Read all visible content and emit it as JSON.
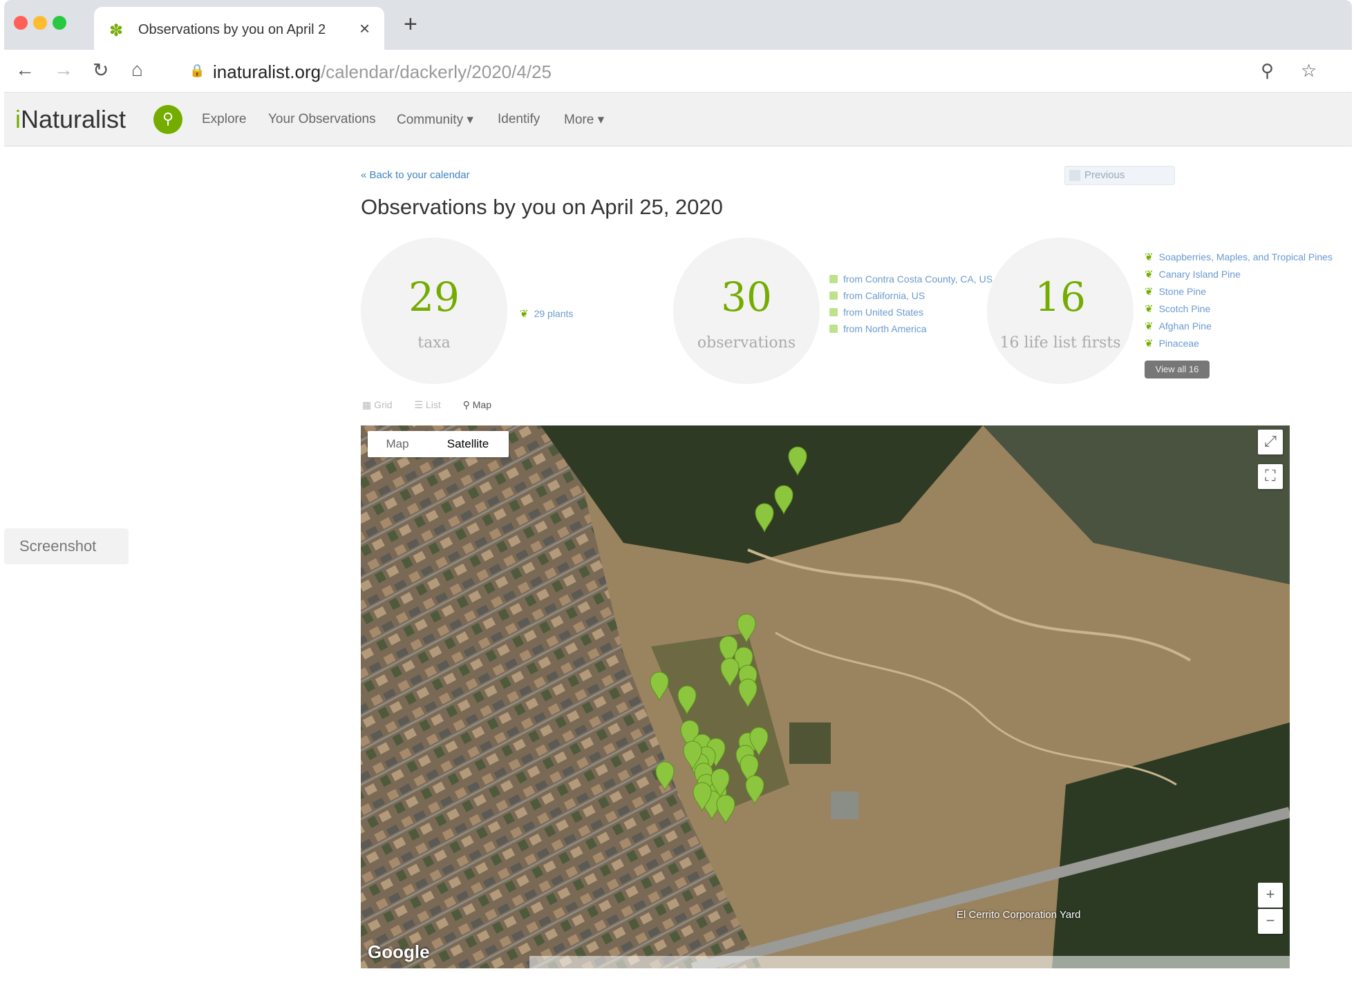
{
  "browser": {
    "tab_title": "Observations by you on April 2",
    "url_domain": "inaturalist.org",
    "url_path": "/calendar/dackerly/2020/4/25"
  },
  "site": {
    "logo_i": "i",
    "logo_rest": "Naturalist",
    "nav": [
      "Explore",
      "Your Observations",
      "Community ▾",
      "Identify",
      "More ▾"
    ]
  },
  "side_label": "Screenshot",
  "page": {
    "back_link": "« Back to your calendar",
    "previous_label": "Previous",
    "title": "Observations by you on April 25, 2020"
  },
  "stats": {
    "taxa": {
      "value": "29",
      "label": "taxa",
      "note": "29 plants"
    },
    "observations": {
      "value": "30",
      "label": "observations",
      "places": [
        "from Contra Costa County, CA, US",
        "from California, US",
        "from United States",
        "from North America"
      ]
    },
    "life_list": {
      "value": "16",
      "label": "16 life list firsts",
      "items": [
        "Soapberries, Maples, and Tropical Pines",
        "Canary Island Pine",
        "Stone Pine",
        "Scotch Pine",
        "Afghan Pine",
        "Pinaceae"
      ],
      "view_all": "View all 16"
    }
  },
  "view_tabs": [
    "Grid",
    "List",
    "Map"
  ],
  "map": {
    "types": [
      "Map",
      "Satellite"
    ],
    "selected_type": "Satellite",
    "place_label": "El Cerrito Corporation Yard",
    "brand": "Google",
    "marker_color": "#8cc63f",
    "marker_count": 30
  },
  "colors": {
    "brand_green": "#74ac00",
    "link_blue": "#4183c4"
  }
}
